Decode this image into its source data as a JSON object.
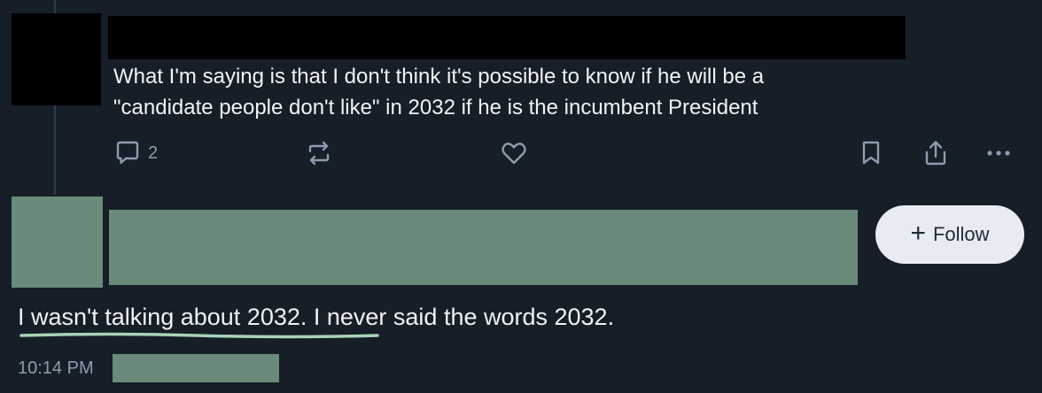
{
  "parent_post": {
    "text_lines": [
      "What I'm saying is that I don't think it's possible to know if he will be a",
      "\"candidate people don't like\" in 2032 if he is the incumbent President"
    ],
    "actions": {
      "reply_count": "2",
      "icons": [
        "reply-icon",
        "repost-icon",
        "like-icon",
        "bookmark-icon",
        "share-icon",
        "more-icon"
      ]
    }
  },
  "focused_post": {
    "follow_label": "Follow",
    "follow_symbol": "+",
    "text": "I wasn't talking about 2032. I never said the words 2032.",
    "timestamp": "10:14 PM"
  },
  "colors": {
    "background": "#161e27",
    "text": "#f1f3f5",
    "muted": "#8c9cb0",
    "redaction_dark": "#000000",
    "redaction_green": "#6a8a7a",
    "underline": "#a9d2b6",
    "follow_bg": "#e8ebf2"
  }
}
